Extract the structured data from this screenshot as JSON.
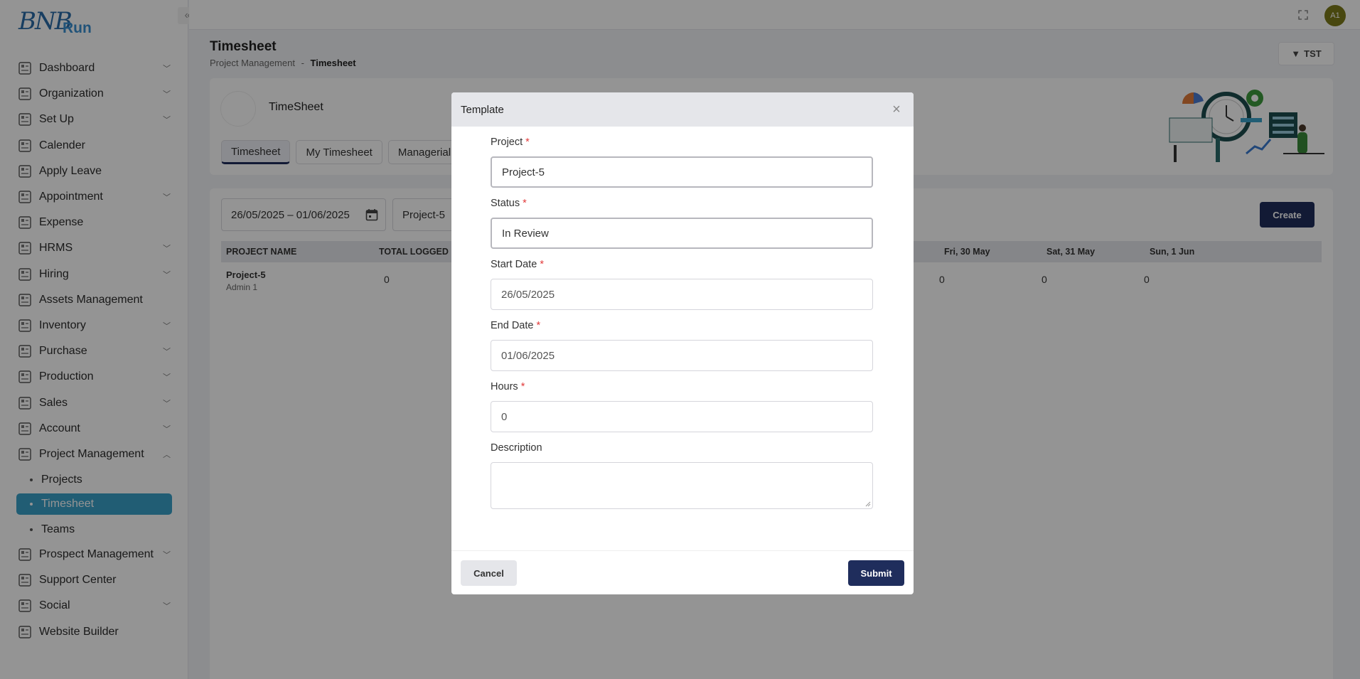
{
  "brand": {
    "logo_text": "BNB",
    "logo_suffix": "Run"
  },
  "topbar": {
    "avatar_initials": "A1"
  },
  "sidebar": {
    "items": [
      {
        "label": "Dashboard",
        "icon": "dashboard-icon",
        "expandable": true
      },
      {
        "label": "Organization",
        "icon": "organization-icon",
        "expandable": true
      },
      {
        "label": "Set Up",
        "icon": "setup-icon",
        "expandable": true
      },
      {
        "label": "Calender",
        "icon": "hourglass-icon",
        "expandable": false
      },
      {
        "label": "Apply Leave",
        "icon": "leave-icon",
        "expandable": false
      },
      {
        "label": "Appointment",
        "icon": "calendar-check-icon",
        "expandable": true
      },
      {
        "label": "Expense",
        "icon": "expense-icon",
        "expandable": false
      },
      {
        "label": "HRMS",
        "icon": "hrms-icon",
        "expandable": true
      },
      {
        "label": "Hiring",
        "icon": "hiring-icon",
        "expandable": true
      },
      {
        "label": "Assets Management",
        "icon": "assets-icon",
        "expandable": false
      },
      {
        "label": "Inventory",
        "icon": "inventory-icon",
        "expandable": true
      },
      {
        "label": "Purchase",
        "icon": "cart-icon",
        "expandable": true
      },
      {
        "label": "Production",
        "icon": "factory-icon",
        "expandable": true
      },
      {
        "label": "Sales",
        "icon": "sales-icon",
        "expandable": true
      },
      {
        "label": "Account",
        "icon": "bank-icon",
        "expandable": true
      },
      {
        "label": "Project Management",
        "icon": "project-icon",
        "expandable": true,
        "expanded": true
      }
    ],
    "project_sub": [
      {
        "label": "Projects"
      },
      {
        "label": "Timesheet",
        "active": true
      },
      {
        "label": "Teams"
      }
    ],
    "items_after": [
      {
        "label": "Prospect Management",
        "icon": "prospect-icon",
        "expandable": true
      },
      {
        "label": "Support Center",
        "icon": "support-icon",
        "expandable": false
      },
      {
        "label": "Social",
        "icon": "social-icon",
        "expandable": true
      },
      {
        "label": "Website Builder",
        "icon": "website-icon",
        "expandable": false
      }
    ]
  },
  "header": {
    "title": "Timesheet",
    "breadcrumb_parent": "Project Management",
    "breadcrumb_sep": "-",
    "breadcrumb_current": "Timesheet",
    "filter_label": "TST"
  },
  "card": {
    "title": "TimeSheet",
    "tabs": [
      "Timesheet",
      "My Timesheet",
      "Managerial"
    ]
  },
  "toolbar": {
    "date_range": "26/05/2025 – 01/06/2025",
    "project": "Project-5",
    "create_label": "Create"
  },
  "table": {
    "headers": [
      "PROJECT NAME",
      "TOTAL LOGGED",
      "Fri, 30 May",
      "Sat, 31 May",
      "Sun, 1 Jun"
    ],
    "row": {
      "project": "Project-5",
      "owner": "Admin 1",
      "total": "0",
      "fri": "0",
      "sat": "0",
      "sun": "0"
    }
  },
  "modal": {
    "title": "Template",
    "project_label": "Project",
    "project_value": "Project-5",
    "status_label": "Status",
    "status_value": "In Review",
    "start_label": "Start Date",
    "start_value": "26/05/2025",
    "end_label": "End Date",
    "end_value": "01/06/2025",
    "hours_label": "Hours",
    "hours_value": "0",
    "description_label": "Description",
    "description_value": "",
    "required_mark": "*",
    "cancel_label": "Cancel",
    "submit_label": "Submit"
  }
}
